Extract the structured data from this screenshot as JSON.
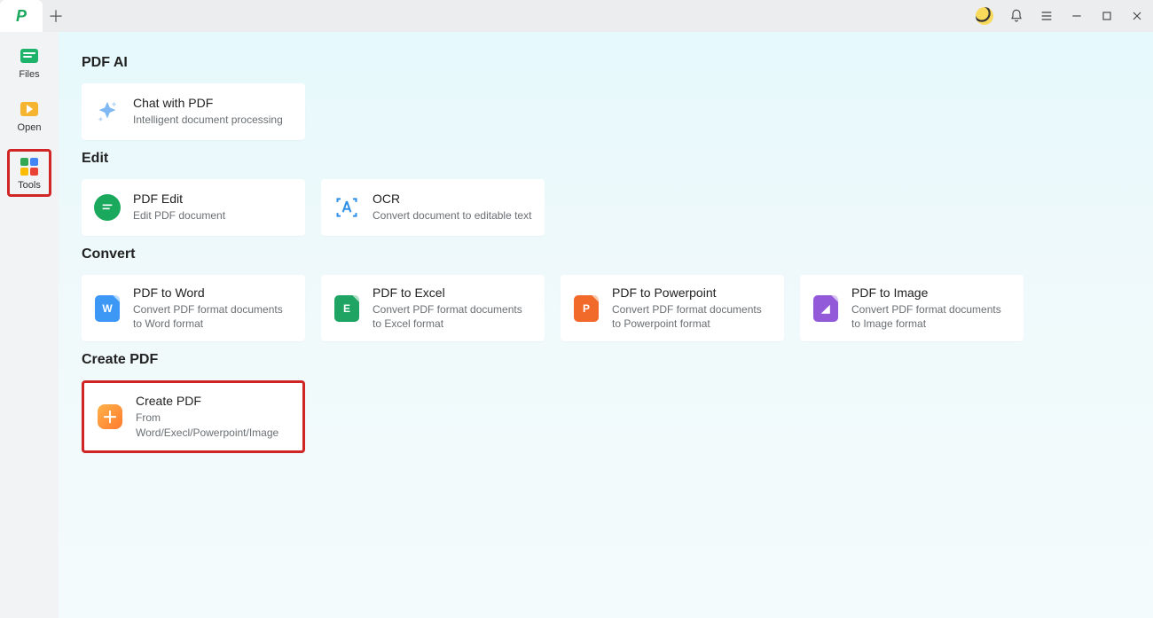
{
  "titlebar": {
    "new_tab_tooltip": "New tab"
  },
  "sidebar": {
    "items": [
      {
        "label": "Files"
      },
      {
        "label": "Open"
      },
      {
        "label": "Tools"
      }
    ]
  },
  "sections": {
    "pdf_ai": {
      "heading": "PDF AI",
      "cards": {
        "chat": {
          "title": "Chat with PDF",
          "desc": "Intelligent document processing"
        }
      }
    },
    "edit": {
      "heading": "Edit",
      "cards": {
        "pdf_edit": {
          "title": "PDF Edit",
          "desc": "Edit PDF document"
        },
        "ocr": {
          "title": "OCR",
          "desc": "Convert document to editable text"
        }
      }
    },
    "convert": {
      "heading": "Convert",
      "cards": {
        "word": {
          "title": "PDF to Word",
          "desc": "Convert PDF format documents to Word format"
        },
        "excel": {
          "title": "PDF to Excel",
          "desc": "Convert PDF format documents to Excel format"
        },
        "ppt": {
          "title": "PDF to Powerpoint",
          "desc": "Convert PDF format documents to Powerpoint format"
        },
        "image": {
          "title": "PDF to Image",
          "desc": "Convert PDF format documents to Image format"
        }
      }
    },
    "create": {
      "heading": "Create PDF",
      "cards": {
        "create": {
          "title": "Create PDF",
          "desc": "From Word/Execl/Powerpoint/Image"
        }
      }
    }
  }
}
